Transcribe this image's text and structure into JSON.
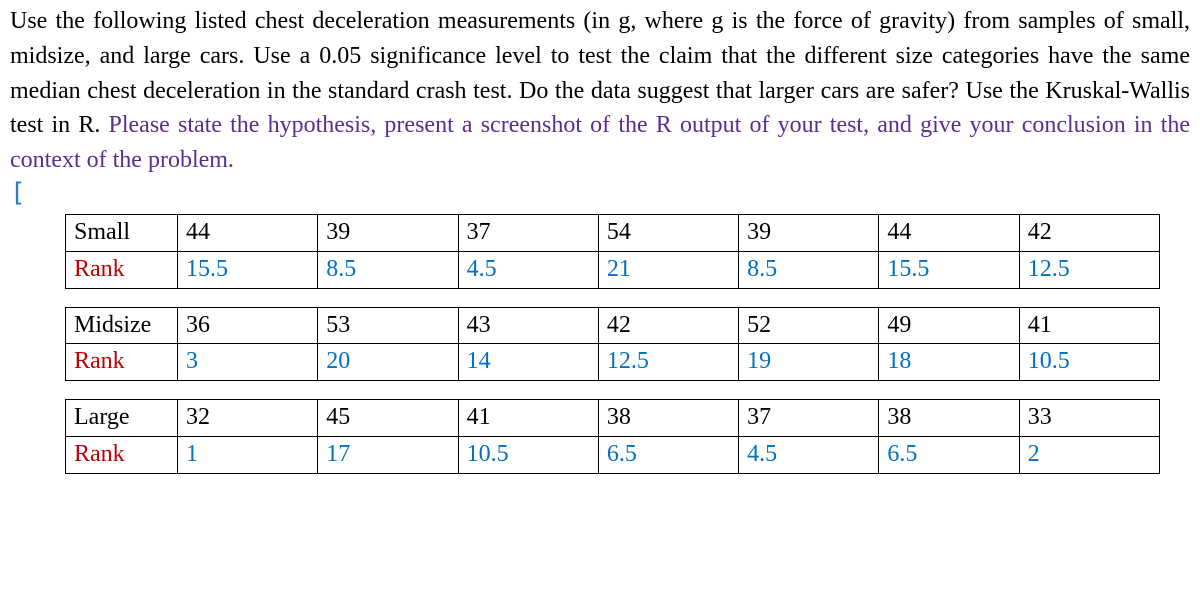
{
  "problem": {
    "part_black": "Use the following listed chest deceleration measurements (in g, where g is the force of gravity) from samples of small, midsize, and large cars. Use a 0.05 significance level to test the claim that the different size categories have the same median chest deceleration in the standard crash test. Do the data suggest that larger cars are safer? Use the Kruskal-Wallis test in R. ",
    "part_purple": "Please state the hypothesis, present a screenshot of the R output of your test, and give your conclusion in the context of the problem."
  },
  "cursor_char": "[",
  "labels": {
    "rank": "Rank"
  },
  "groups": [
    {
      "name": "Small",
      "values": [
        "44",
        "39",
        "37",
        "54",
        "39",
        "44",
        "42"
      ],
      "ranks": [
        "15.5",
        "8.5",
        "4.5",
        "21",
        "8.5",
        "15.5",
        "12.5"
      ]
    },
    {
      "name": "Midsize",
      "values": [
        "36",
        "53",
        "43",
        "42",
        "52",
        "49",
        "41"
      ],
      "ranks": [
        "3",
        "20",
        "14",
        "12.5",
        "19",
        "18",
        "10.5"
      ]
    },
    {
      "name": "Large",
      "values": [
        "32",
        "45",
        "41",
        "38",
        "37",
        "38",
        "33"
      ],
      "ranks": [
        "1",
        "17",
        "10.5",
        "6.5",
        "4.5",
        "6.5",
        "2"
      ]
    }
  ]
}
